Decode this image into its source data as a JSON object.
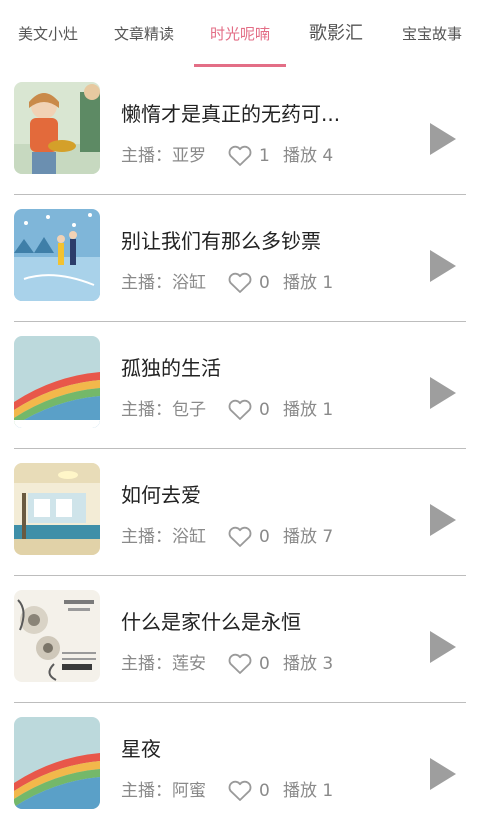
{
  "tabs": [
    {
      "label": "美文小灶",
      "active": false
    },
    {
      "label": "文章精读",
      "active": false
    },
    {
      "label": "时光呢喃",
      "active": true
    },
    {
      "label": "歌影汇",
      "active": false
    },
    {
      "label": "宝宝故事",
      "active": false
    }
  ],
  "colors": {
    "accent": "#e36e86",
    "divider": "#bdbdbd",
    "text_primary": "#222222",
    "text_secondary": "#8a8a8a",
    "play_icon": "#9e9e9e"
  },
  "items": [
    {
      "title": "懒惰才是真正的无药可...",
      "host": "主播：亚罗",
      "likes": "1",
      "plays": "播放 4",
      "thumb_icon": "illustration-girl-eating-icon"
    },
    {
      "title": "别让我们有那么多钞票",
      "host": "主播：浴缸",
      "likes": "0",
      "plays": "播放 1",
      "thumb_icon": "illustration-couple-snow-icon"
    },
    {
      "title": "孤独的生活",
      "host": "主播：包子",
      "likes": "0",
      "plays": "播放 1",
      "thumb_icon": "illustration-rainbow-icon"
    },
    {
      "title": "如何去爱",
      "host": "主播：浴缸",
      "likes": "0",
      "plays": "播放 7",
      "thumb_icon": "illustration-interior-icon"
    },
    {
      "title": "什么是家什么是永恒",
      "host": "主播：莲安",
      "likes": "0",
      "plays": "播放 3",
      "thumb_icon": "illustration-flowers-poster-icon"
    },
    {
      "title": "星夜",
      "host": "主播：阿蜜",
      "likes": "0",
      "plays": "播放 1",
      "thumb_icon": "illustration-rainbow-icon"
    }
  ]
}
